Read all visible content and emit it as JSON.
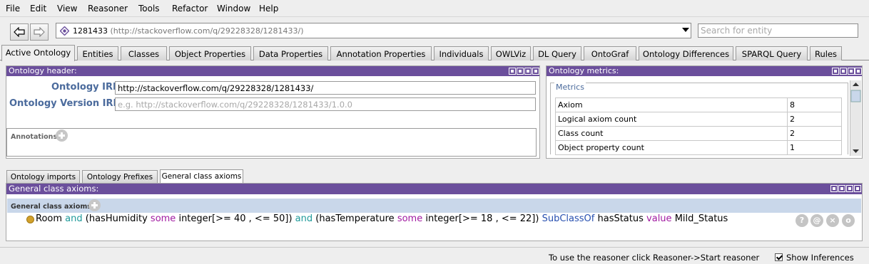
{
  "menu": [
    "File",
    "Edit",
    "View",
    "Reasoner",
    "Tools",
    "Refactor",
    "Window",
    "Help"
  ],
  "toolbar": {
    "entity_name": "1281433",
    "entity_iri": "(http://stackoverflow.com/q/29228328/1281433/)",
    "search_placeholder": "Search for entity"
  },
  "tabs": [
    "Active Ontology",
    "Entities",
    "Classes",
    "Object Properties",
    "Data Properties",
    "Annotation Properties",
    "Individuals",
    "OWLViz",
    "DL Query",
    "OntoGraf",
    "Ontology Differences",
    "SPARQL Query",
    "Rules"
  ],
  "active_tab": "Active Ontology",
  "header_panel": {
    "title": "Ontology header:",
    "iri_label": "Ontology IRI",
    "iri_value": "http://stackoverflow.com/q/29228328/1281433/",
    "version_label": "Ontology Version IRI",
    "version_placeholder": "e.g. http://stackoverflow.com/q/29228328/1281433/1.0.0",
    "annotations_label": "Annotations"
  },
  "metrics_panel": {
    "title": "Ontology metrics:",
    "group_label": "Metrics",
    "rows": [
      {
        "name": "Axiom",
        "value": "8"
      },
      {
        "name": "Logical axiom count",
        "value": "2"
      },
      {
        "name": "Class count",
        "value": "2"
      },
      {
        "name": "Object property count",
        "value": "1"
      }
    ]
  },
  "sub_tabs": [
    "Ontology imports",
    "Ontology Prefixes",
    "General class axioms"
  ],
  "gca_panel": {
    "title": "General class axioms:",
    "section_label": "General class axioms",
    "axiom": {
      "room": "Room",
      "and1": "and",
      "hum_open": "(hasHumidity",
      "some1": "some",
      "hum_range": "integer[>= 40 , <= 50])",
      "and2": "and",
      "temp_open": "(hasTemperature",
      "some2": "some",
      "temp_range": "integer[>= 18 , <= 22])",
      "subclassof": "SubClassOf",
      "status_prop": "hasStatus",
      "value_kw": "value",
      "status_val": "Mild_Status"
    },
    "buttons": [
      "?",
      "@",
      "×",
      "o"
    ]
  },
  "status": {
    "message": "To use the reasoner click Reasoner->Start reasoner",
    "show_inferences_label": "Show Inferences",
    "show_inferences_checked": true
  },
  "colors": {
    "panel_title": "#6b4f9c",
    "iri_label": "#4a6a9c",
    "keyword_teal": "#1e9a9a",
    "keyword_purple": "#a11aa1",
    "keyword_blue": "#2850b0"
  }
}
